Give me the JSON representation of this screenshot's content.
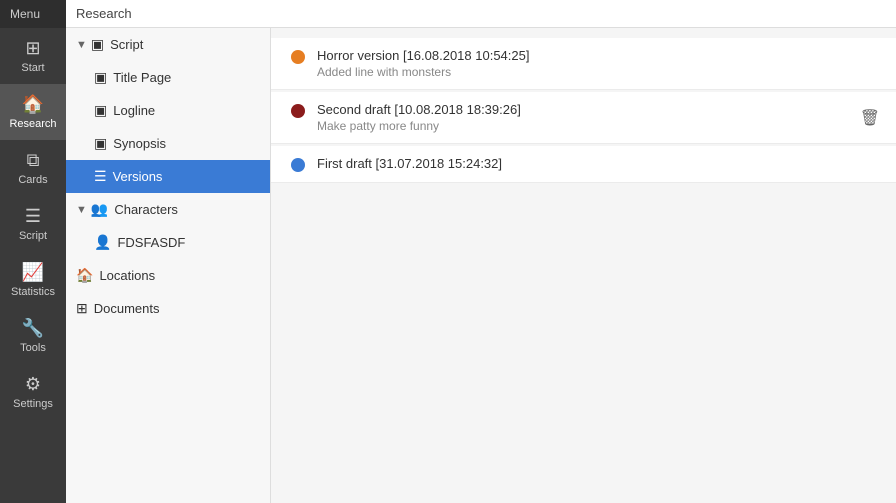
{
  "nav": {
    "items": [
      {
        "id": "start",
        "label": "Start",
        "icon": "⊞"
      },
      {
        "id": "research",
        "label": "Research",
        "icon": "🏠",
        "active": true
      },
      {
        "id": "cards",
        "label": "Cards",
        "icon": "⧉"
      },
      {
        "id": "script",
        "label": "Script",
        "icon": "☰"
      },
      {
        "id": "statistics",
        "label": "Statistics",
        "icon": "📈"
      },
      {
        "id": "tools",
        "label": "Tools",
        "icon": "🔧"
      },
      {
        "id": "settings",
        "label": "Settings",
        "icon": "⚙"
      }
    ]
  },
  "topbar": {
    "title": "Research"
  },
  "sidebar": {
    "menu_label": "Menu",
    "script_section": {
      "label": "Script",
      "items": [
        {
          "id": "title-page",
          "label": "Title Page",
          "icon": "▣"
        },
        {
          "id": "logline",
          "label": "Logline",
          "icon": "▣"
        },
        {
          "id": "synopsis",
          "label": "Synopsis",
          "icon": "▣"
        },
        {
          "id": "versions",
          "label": "Versions",
          "icon": "☰",
          "active": true
        }
      ]
    },
    "characters_section": {
      "label": "Characters",
      "items": [
        {
          "id": "fdsfasdf",
          "label": "FDSFASDF",
          "icon": "👤"
        }
      ]
    },
    "locations_label": "Locations",
    "documents_label": "Documents"
  },
  "versions": [
    {
      "id": "v1",
      "title": "Horror version [16.08.2018 10:54:25]",
      "subtitle": "Added line with monsters",
      "dot_color": "#e67e22"
    },
    {
      "id": "v2",
      "title": "Second draft [10.08.2018 18:39:26]",
      "subtitle": "Make patty more funny",
      "dot_color": "#8b1c1c",
      "show_delete": true
    },
    {
      "id": "v3",
      "title": "First draft [31.07.2018 15:24:32]",
      "subtitle": "",
      "dot_color": "#3a7bd5"
    }
  ]
}
